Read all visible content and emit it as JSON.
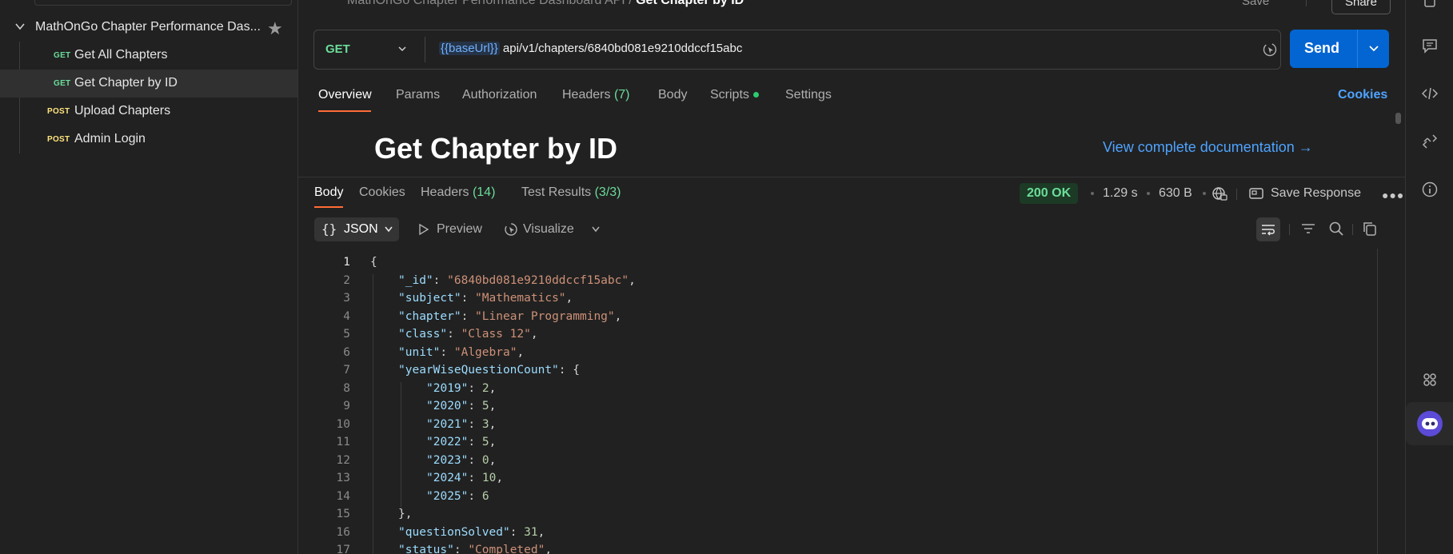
{
  "sidebar": {
    "collection_name": "MathOnGo Chapter Performance Das...",
    "requests": [
      {
        "method": "GET",
        "label": "Get All Chapters"
      },
      {
        "method": "GET",
        "label": "Get Chapter by ID"
      },
      {
        "method": "POST",
        "label": "Upload Chapters"
      },
      {
        "method": "POST",
        "label": "Admin Login"
      }
    ]
  },
  "header": {
    "breadcrumb_parent": "MathOnGo Chapter Performance Dashboard API",
    "breadcrumb_sep": "/",
    "breadcrumb_current": "Get Chapter by ID",
    "save_label": "Save",
    "share_label": "Share"
  },
  "request": {
    "method": "GET",
    "url_var": "{{baseUrl}}",
    "url_path": "api/v1/chapters/6840bd081e9210ddccf15abc",
    "send_label": "Send"
  },
  "tabs": {
    "overview": "Overview",
    "params": "Params",
    "authorization": "Authorization",
    "headers": "Headers",
    "headers_count": "(7)",
    "body": "Body",
    "scripts": "Scripts",
    "settings": "Settings",
    "cookies": "Cookies"
  },
  "docs": {
    "title": "Get Chapter by ID",
    "link": "View complete documentation →"
  },
  "response": {
    "tabs": {
      "body": "Body",
      "cookies": "Cookies",
      "headers": "Headers",
      "headers_count": "(14)",
      "test_results": "Test Results",
      "test_count": "(3/3)"
    },
    "status": "200 OK",
    "time": "1.29 s",
    "size": "630 B",
    "save_response": "Save Response",
    "format": "JSON",
    "preview": "Preview",
    "visualize": "Visualize"
  },
  "code_lines": [
    {
      "n": "1",
      "indent": 0,
      "parts": [
        {
          "t": "p",
          "v": "{"
        }
      ]
    },
    {
      "n": "2",
      "indent": 1,
      "parts": [
        {
          "t": "k",
          "v": "\"_id\""
        },
        {
          "t": "p",
          "v": ": "
        },
        {
          "t": "s",
          "v": "\"6840bd081e9210ddccf15abc\""
        },
        {
          "t": "p",
          "v": ","
        }
      ]
    },
    {
      "n": "3",
      "indent": 1,
      "parts": [
        {
          "t": "k",
          "v": "\"subject\""
        },
        {
          "t": "p",
          "v": ": "
        },
        {
          "t": "s",
          "v": "\"Mathematics\""
        },
        {
          "t": "p",
          "v": ","
        }
      ]
    },
    {
      "n": "4",
      "indent": 1,
      "parts": [
        {
          "t": "k",
          "v": "\"chapter\""
        },
        {
          "t": "p",
          "v": ": "
        },
        {
          "t": "s",
          "v": "\"Linear Programming\""
        },
        {
          "t": "p",
          "v": ","
        }
      ]
    },
    {
      "n": "5",
      "indent": 1,
      "parts": [
        {
          "t": "k",
          "v": "\"class\""
        },
        {
          "t": "p",
          "v": ": "
        },
        {
          "t": "s",
          "v": "\"Class 12\""
        },
        {
          "t": "p",
          "v": ","
        }
      ]
    },
    {
      "n": "6",
      "indent": 1,
      "parts": [
        {
          "t": "k",
          "v": "\"unit\""
        },
        {
          "t": "p",
          "v": ": "
        },
        {
          "t": "s",
          "v": "\"Algebra\""
        },
        {
          "t": "p",
          "v": ","
        }
      ]
    },
    {
      "n": "7",
      "indent": 1,
      "parts": [
        {
          "t": "k",
          "v": "\"yearWiseQuestionCount\""
        },
        {
          "t": "p",
          "v": ": {"
        }
      ]
    },
    {
      "n": "8",
      "indent": 2,
      "parts": [
        {
          "t": "k",
          "v": "\"2019\""
        },
        {
          "t": "p",
          "v": ": "
        },
        {
          "t": "n",
          "v": "2"
        },
        {
          "t": "p",
          "v": ","
        }
      ]
    },
    {
      "n": "9",
      "indent": 2,
      "parts": [
        {
          "t": "k",
          "v": "\"2020\""
        },
        {
          "t": "p",
          "v": ": "
        },
        {
          "t": "n",
          "v": "5"
        },
        {
          "t": "p",
          "v": ","
        }
      ]
    },
    {
      "n": "10",
      "indent": 2,
      "parts": [
        {
          "t": "k",
          "v": "\"2021\""
        },
        {
          "t": "p",
          "v": ": "
        },
        {
          "t": "n",
          "v": "3"
        },
        {
          "t": "p",
          "v": ","
        }
      ]
    },
    {
      "n": "11",
      "indent": 2,
      "parts": [
        {
          "t": "k",
          "v": "\"2022\""
        },
        {
          "t": "p",
          "v": ": "
        },
        {
          "t": "n",
          "v": "5"
        },
        {
          "t": "p",
          "v": ","
        }
      ]
    },
    {
      "n": "12",
      "indent": 2,
      "parts": [
        {
          "t": "k",
          "v": "\"2023\""
        },
        {
          "t": "p",
          "v": ": "
        },
        {
          "t": "n",
          "v": "0"
        },
        {
          "t": "p",
          "v": ","
        }
      ]
    },
    {
      "n": "13",
      "indent": 2,
      "parts": [
        {
          "t": "k",
          "v": "\"2024\""
        },
        {
          "t": "p",
          "v": ": "
        },
        {
          "t": "n",
          "v": "10"
        },
        {
          "t": "p",
          "v": ","
        }
      ]
    },
    {
      "n": "14",
      "indent": 2,
      "parts": [
        {
          "t": "k",
          "v": "\"2025\""
        },
        {
          "t": "p",
          "v": ": "
        },
        {
          "t": "n",
          "v": "6"
        }
      ]
    },
    {
      "n": "15",
      "indent": 1,
      "parts": [
        {
          "t": "p",
          "v": "},"
        }
      ]
    },
    {
      "n": "16",
      "indent": 1,
      "parts": [
        {
          "t": "k",
          "v": "\"questionSolved\""
        },
        {
          "t": "p",
          "v": ": "
        },
        {
          "t": "n",
          "v": "31"
        },
        {
          "t": "p",
          "v": ","
        }
      ]
    },
    {
      "n": "17",
      "indent": 1,
      "parts": [
        {
          "t": "k",
          "v": "\"status\""
        },
        {
          "t": "p",
          "v": ": "
        },
        {
          "t": "s",
          "v": "\"Completed\""
        },
        {
          "t": "p",
          "v": ","
        }
      ]
    }
  ],
  "colors": {
    "accent_orange": "#ff6c37",
    "send_blue": "#0265d2",
    "get_green": "#6bdd9a",
    "post_yellow": "#ffe47e",
    "link_blue": "#4ea3ff"
  }
}
